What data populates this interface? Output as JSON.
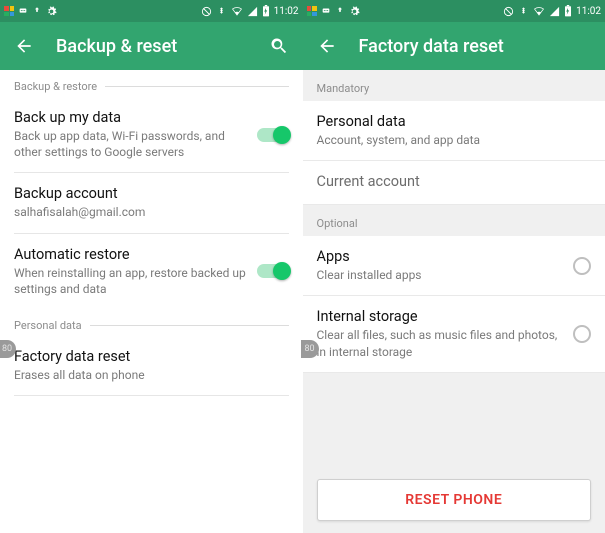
{
  "status": {
    "time": "11:02"
  },
  "left": {
    "title": "Backup & reset",
    "section1": "Backup & restore",
    "backup_data": {
      "title": "Back up my data",
      "sub": "Back up app data, Wi-Fi passwords, and other settings to Google servers"
    },
    "backup_account": {
      "title": "Backup account",
      "sub": "salhafisalah@gmail.com"
    },
    "auto_restore": {
      "title": "Automatic restore",
      "sub": "When reinstalling an app, restore backed up settings and data"
    },
    "section2": "Personal data",
    "factory": {
      "title": "Factory data reset",
      "sub": "Erases all data on phone"
    }
  },
  "right": {
    "title": "Factory data reset",
    "section1": "Mandatory",
    "personal": {
      "title": "Personal data",
      "sub": "Account, system, and app data"
    },
    "current_account": {
      "title": "Current account"
    },
    "section2": "Optional",
    "apps": {
      "title": "Apps",
      "sub": "Clear installed apps"
    },
    "storage": {
      "title": "Internal storage",
      "sub": "Clear all files, such as music files and photos, in internal storage"
    },
    "reset_button": "RESET PHONE"
  },
  "watermark": "80"
}
